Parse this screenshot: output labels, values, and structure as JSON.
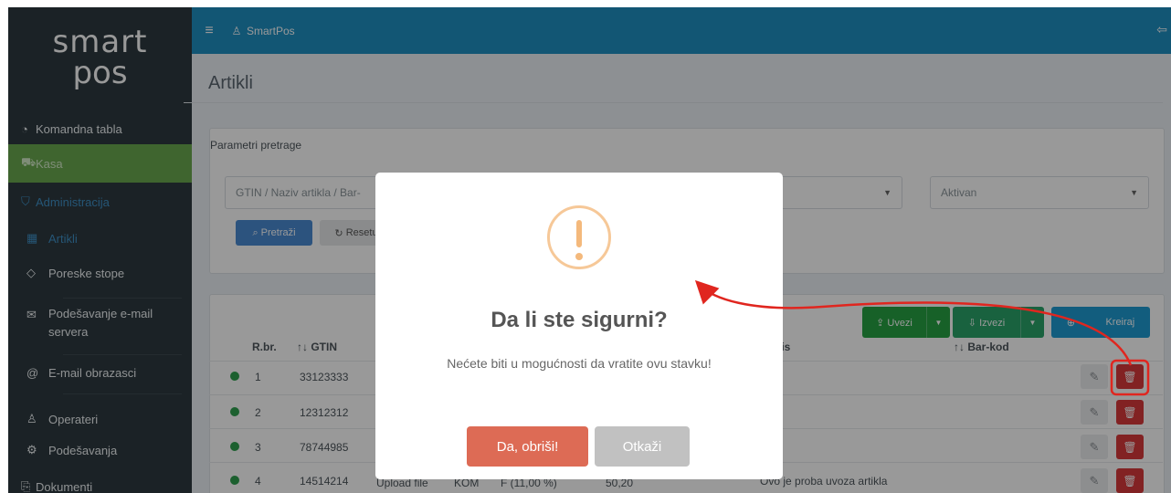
{
  "brand": {
    "logo_line1": "smart",
    "logo_line2": "pos"
  },
  "sidebar": {
    "items": [
      {
        "label": "Komandna tabla",
        "icon": "gauge-icon"
      },
      {
        "label": "Kasa",
        "icon": "cart-icon"
      },
      {
        "label": "Administracija",
        "icon": "shield-icon"
      },
      {
        "label": "Artikli",
        "icon": "grid-icon"
      },
      {
        "label": "Poreske stope",
        "icon": "tag-icon"
      },
      {
        "label": "Podešavanje e-mail",
        "label2": "servera",
        "icon": "envelope-icon"
      },
      {
        "label": "E-mail obrazasci",
        "icon": "at-icon"
      },
      {
        "label": "Operateri",
        "icon": "users-icon"
      },
      {
        "label": "Podešavanja",
        "icon": "gear-icon"
      },
      {
        "label": "Dokumenti",
        "icon": "document-icon"
      }
    ]
  },
  "topbar": {
    "app_name": "SmartPos"
  },
  "page": {
    "title": "Artikli"
  },
  "search": {
    "section_label": "Parametri pretrage",
    "text_placeholder": "GTIN / Naziv artikla / Bar-",
    "status_value": "Aktivan",
    "search_label": "Pretraži",
    "reset_label": "Resetu"
  },
  "toolbar": {
    "import_label": "Uvezi",
    "export_label": "Izvezi",
    "create_label": "Kreiraj"
  },
  "table": {
    "headers": {
      "rbr": "R.br.",
      "gtin": "↑↓ GTIN",
      "opis": "pis",
      "barkod": "↑↓ Bar-kod"
    },
    "rows": [
      {
        "rbr": "1",
        "gtin": "33123333"
      },
      {
        "rbr": "2",
        "gtin": "12312312"
      },
      {
        "rbr": "3",
        "gtin": "78744985"
      },
      {
        "rbr": "4",
        "gtin": "14514214",
        "naziv": "Upload file",
        "jm": "KOM",
        "stopa": "F (11,00 %)",
        "cena": "50,20",
        "opis": "Ovo je proba uvoza artikla"
      }
    ]
  },
  "modal": {
    "title": "Da li ste sigurni?",
    "text": "Nećete biti u mogućnosti da vratite ovu stavku!",
    "confirm_label": "Da, obriši!",
    "cancel_label": "Otkaži"
  },
  "colors": {
    "sidebar_bg": "#2d3a40",
    "topbar_bg": "#1f8fc2",
    "kasa_green": "#6aa84f",
    "confirm": "#dd6b55",
    "cancel": "#c1c1c1",
    "danger": "#d9393b",
    "annotation_red": "#e0261f"
  }
}
